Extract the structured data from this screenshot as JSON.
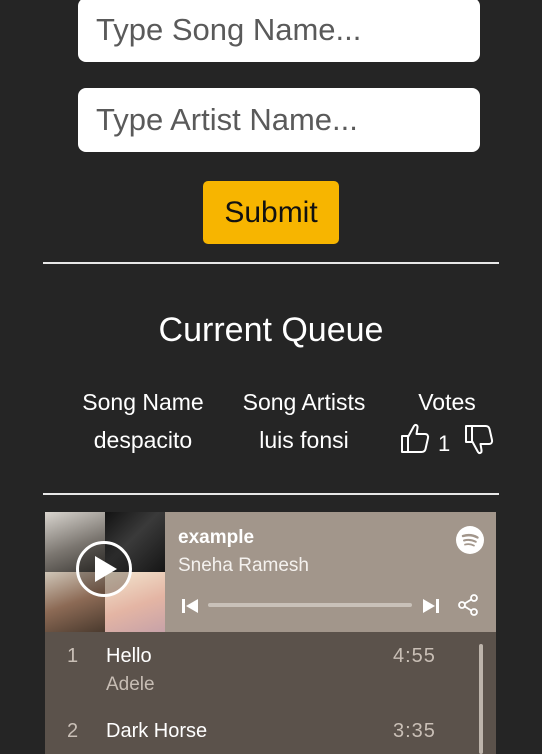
{
  "form": {
    "song_placeholder": "Type Song Name...",
    "artist_placeholder": "Type Artist Name...",
    "submit_label": "Submit"
  },
  "queue": {
    "title": "Current Queue",
    "columns": [
      "Song Name",
      "Song Artists",
      "Votes"
    ],
    "rows": [
      {
        "song": "despacito",
        "artist": "luis fonsi",
        "votes": "1"
      }
    ]
  },
  "player": {
    "title": "example",
    "owner": "Sneha Ramesh",
    "icons": [
      "play-icon",
      "spotify-icon",
      "previous-icon",
      "next-icon",
      "share-icon"
    ],
    "tracks": [
      {
        "num": "1",
        "name": "Hello",
        "artist": "Adele",
        "duration": "4:55"
      },
      {
        "num": "2",
        "name": "Dark Horse",
        "artist": "",
        "duration": "3:35"
      }
    ]
  },
  "colors": {
    "background": "#252525",
    "accent": "#f7b500",
    "player_header": "#a2968b",
    "player_body": "#5b524b"
  }
}
